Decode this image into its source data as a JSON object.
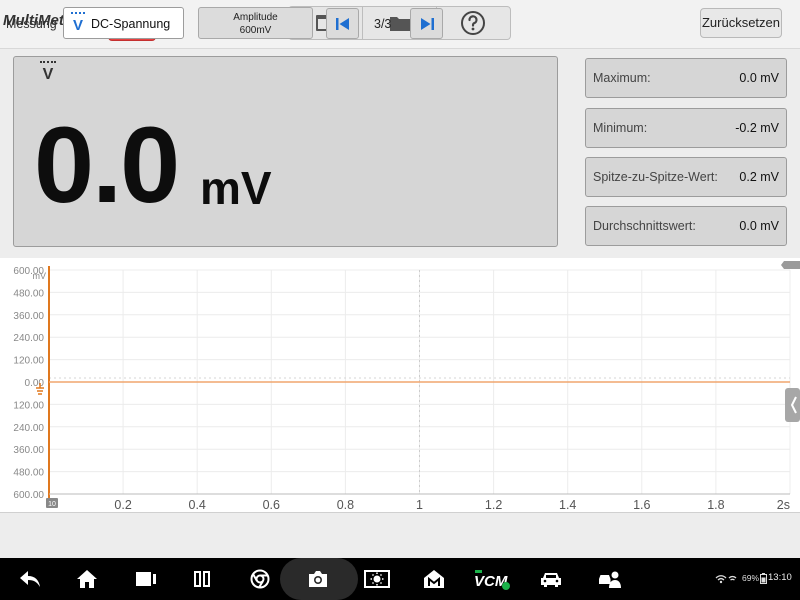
{
  "app": {
    "title": "MultiMeter"
  },
  "toolbar": {
    "reset_label": "Zurücksetzen"
  },
  "readout": {
    "mode_symbol": "V",
    "value": "0.0",
    "unit": "mV"
  },
  "stats": [
    {
      "label": "Maximum:",
      "value": "0.0 mV"
    },
    {
      "label": "Minimum:",
      "value": "-0.2 mV"
    },
    {
      "label": "Spitze-zu-Spitze-Wert:",
      "value": "0.2 mV"
    },
    {
      "label": "Durchschnittswert:",
      "value": "0.0 mV"
    }
  ],
  "chart_data": {
    "type": "line",
    "y_unit": "mV",
    "x_unit": "s",
    "ylim": [
      -600,
      600
    ],
    "xlim": [
      0,
      2
    ],
    "y_ticks": [
      "600.00",
      "480.00",
      "360.00",
      "240.00",
      "120.00",
      "0.00",
      "120.00",
      "240.00",
      "360.00",
      "480.00",
      "600.00"
    ],
    "x_ticks": [
      "0.2",
      "0.4",
      "0.6",
      "0.8",
      "1",
      "1.2",
      "1.4",
      "1.6",
      "1.8",
      "2s"
    ],
    "x_start_badge": "10",
    "series": [
      {
        "x": [
          0,
          2
        ],
        "y": [
          0,
          0
        ],
        "color": "#f0a56e"
      }
    ],
    "grid": true
  },
  "controls": {
    "measurement_label": "Messung",
    "measurement_mode_symbol": "V",
    "measurement_value": "DC-Spannung",
    "amplitude_label": "Amplitude",
    "amplitude_value": "600mV",
    "page_indicator": "3/3"
  },
  "statusbar": {
    "battery": "69%",
    "time": "13:10"
  },
  "colors": {
    "stop": "#e94141",
    "axis": "#e0781e",
    "accent": "#1f6fd1",
    "status_ok": "#1bb24a"
  }
}
